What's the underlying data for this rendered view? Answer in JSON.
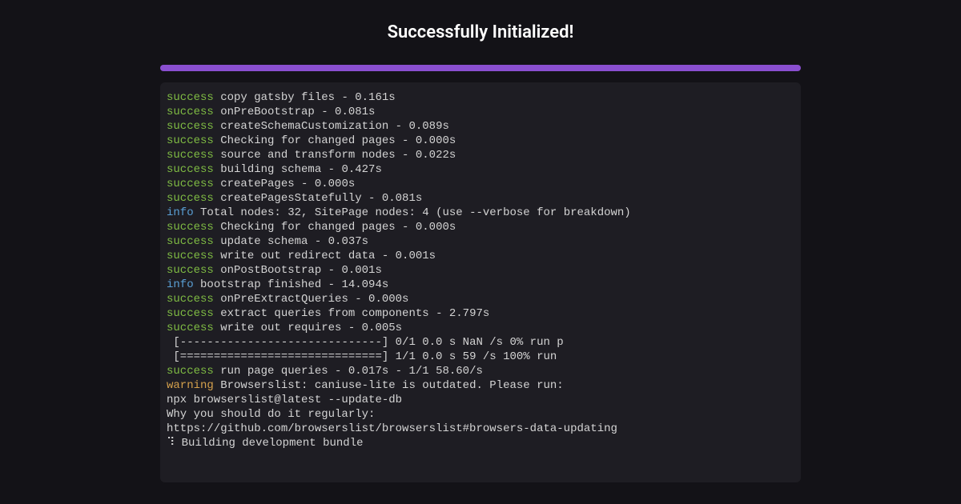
{
  "header": {
    "title": "Successfully Initialized!"
  },
  "colors": {
    "accent": "#8a4fd0",
    "success": "#7fbc43",
    "info": "#5a9fd4",
    "warning": "#d4a04c",
    "bg": "#131217",
    "terminal_bg": "#1e1d23"
  },
  "terminal": {
    "lines": [
      {
        "tag": "success",
        "text": "copy gatsby files - 0.161s"
      },
      {
        "tag": "success",
        "text": "onPreBootstrap - 0.081s"
      },
      {
        "tag": "success",
        "text": "createSchemaCustomization - 0.089s"
      },
      {
        "tag": "success",
        "text": "Checking for changed pages - 0.000s"
      },
      {
        "tag": "success",
        "text": "source and transform nodes - 0.022s"
      },
      {
        "tag": "success",
        "text": "building schema - 0.427s"
      },
      {
        "tag": "success",
        "text": "createPages - 0.000s"
      },
      {
        "tag": "success",
        "text": "createPagesStatefully - 0.081s"
      },
      {
        "tag": "info",
        "text": "Total nodes: 32, SitePage nodes: 4 (use --verbose for breakdown)"
      },
      {
        "tag": "success",
        "text": "Checking for changed pages - 0.000s"
      },
      {
        "tag": "success",
        "text": "update schema - 0.037s"
      },
      {
        "tag": "success",
        "text": "write out redirect data - 0.001s"
      },
      {
        "tag": "success",
        "text": "onPostBootstrap - 0.001s"
      },
      {
        "tag": "info",
        "text": "bootstrap finished - 14.094s"
      },
      {
        "tag": "success",
        "text": "onPreExtractQueries - 0.000s"
      },
      {
        "tag": "success",
        "text": "extract queries from components - 2.797s"
      },
      {
        "tag": "success",
        "text": "write out requires - 0.005s"
      },
      {
        "tag": "",
        "text": " [------------------------------] 0/1 0.0 s NaN /s 0% run p"
      },
      {
        "tag": "",
        "text": " [==============================] 1/1 0.0 s 59 /s 100% run"
      },
      {
        "tag": "success",
        "text": "run page queries - 0.017s - 1/1 58.60/s"
      },
      {
        "tag": "warning",
        "text": "Browserslist: caniuse-lite is outdated. Please run:"
      },
      {
        "tag": "",
        "text": "npx browserslist@latest --update-db"
      },
      {
        "tag": "",
        "text": ""
      },
      {
        "tag": "",
        "text": "Why you should do it regularly:"
      },
      {
        "tag": "",
        "text": "https://github.com/browserslist/browserslist#browsers-data-updating"
      },
      {
        "tag": "",
        "text": "⠹ Building development bundle"
      }
    ]
  }
}
